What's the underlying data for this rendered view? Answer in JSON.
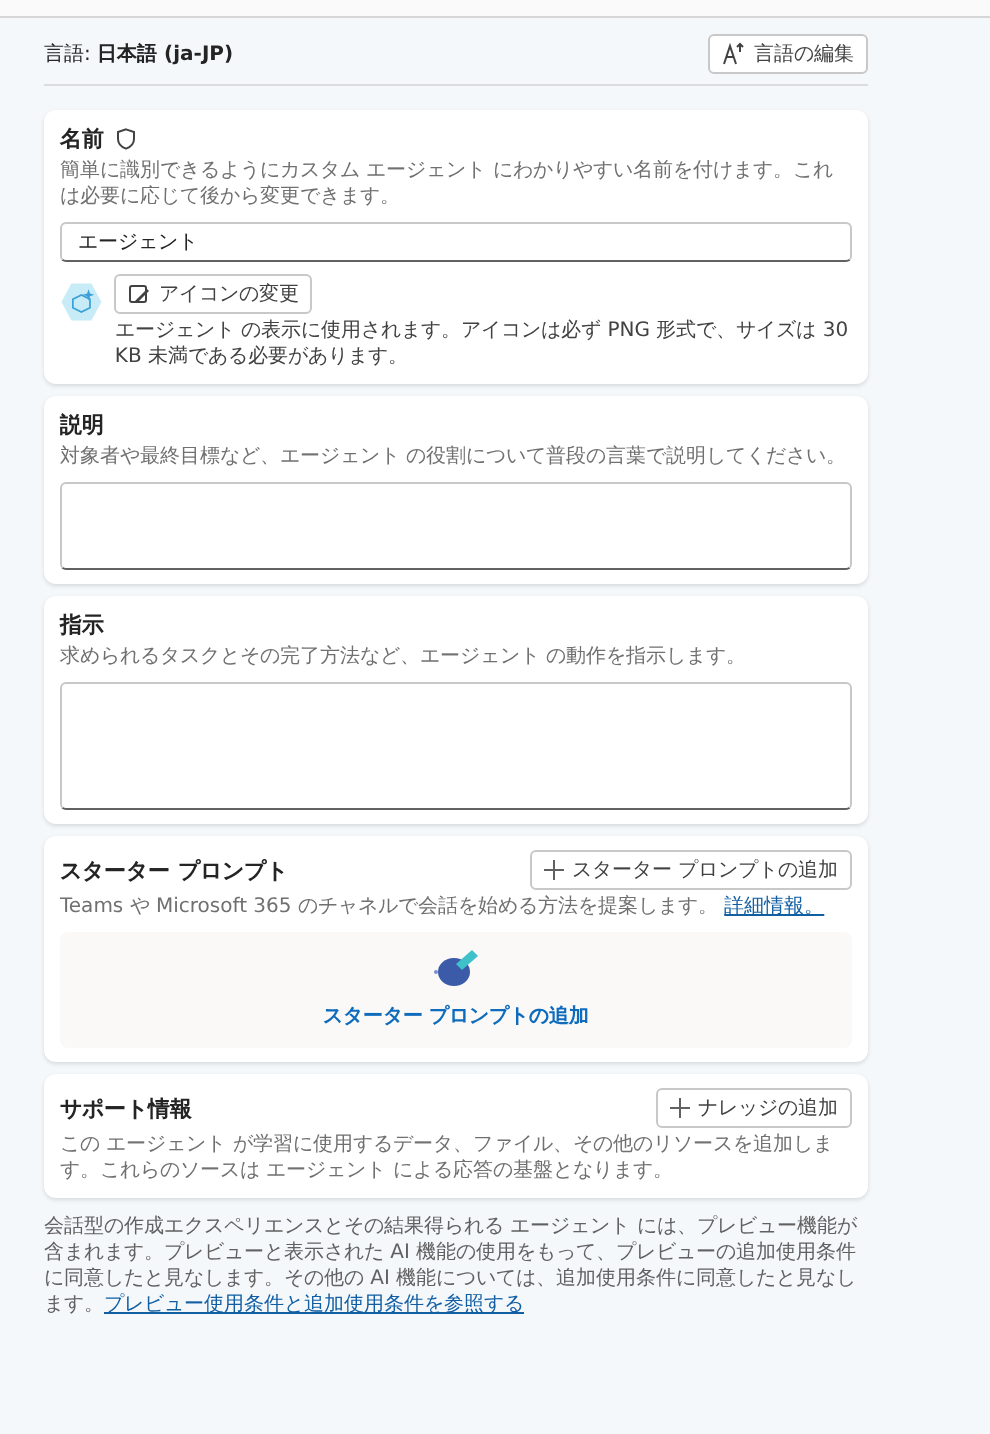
{
  "language": {
    "label": "言語: **日本語 (ja-JP)**",
    "edit_button": "言語の編集"
  },
  "name_section": {
    "title": "名前",
    "description": "簡単に識別できるようにカスタム エージェント にわかりやすい名前を付けます。これは必要に応じて後から変更できます。",
    "value": "エージェント",
    "change_icon_button": "アイコンの変更",
    "icon_note": "エージェント の表示に使用されます。アイコンは必ず PNG 形式で、サイズは 30 KB 未満である必要があります。"
  },
  "text_sections": [
    {
      "title": "説明",
      "description": "対象者や最終目標など、エージェント の役割について普段の言葉で説明してください。"
    },
    {
      "title": "指示",
      "description": "求められるタスクとその完了方法など、エージェント の動作を指示します。"
    }
  ],
  "starter_prompts": {
    "title": "スターター プロンプト",
    "add_button": "スターター プロンプトの追加",
    "description": "Teams や Microsoft 365 のチャネルで会話を始める方法を提案します。",
    "link": "詳細情報。",
    "empty_action": "スターター プロンプトの追加"
  },
  "knowledge": {
    "title": "サポート情報",
    "add_button": "ナレッジの追加",
    "description": "この エージェント が学習に使用するデータ、ファイル、その他のリソースを追加します。これらのソースは エージェント による応答の基盤となります。"
  },
  "footer": {
    "text": "会話型の作成エクスペリエンスとその結果得られる エージェント には、プレビュー機能が含まれます。プレビューと表示された AI 機能の使用をもって、プレビューの追加使用条件に同意したと見なします。その他の AI 機能については、追加使用条件に同意したと見なします。",
    "link": "プレビュー使用条件と追加使用条件を参照する"
  }
}
